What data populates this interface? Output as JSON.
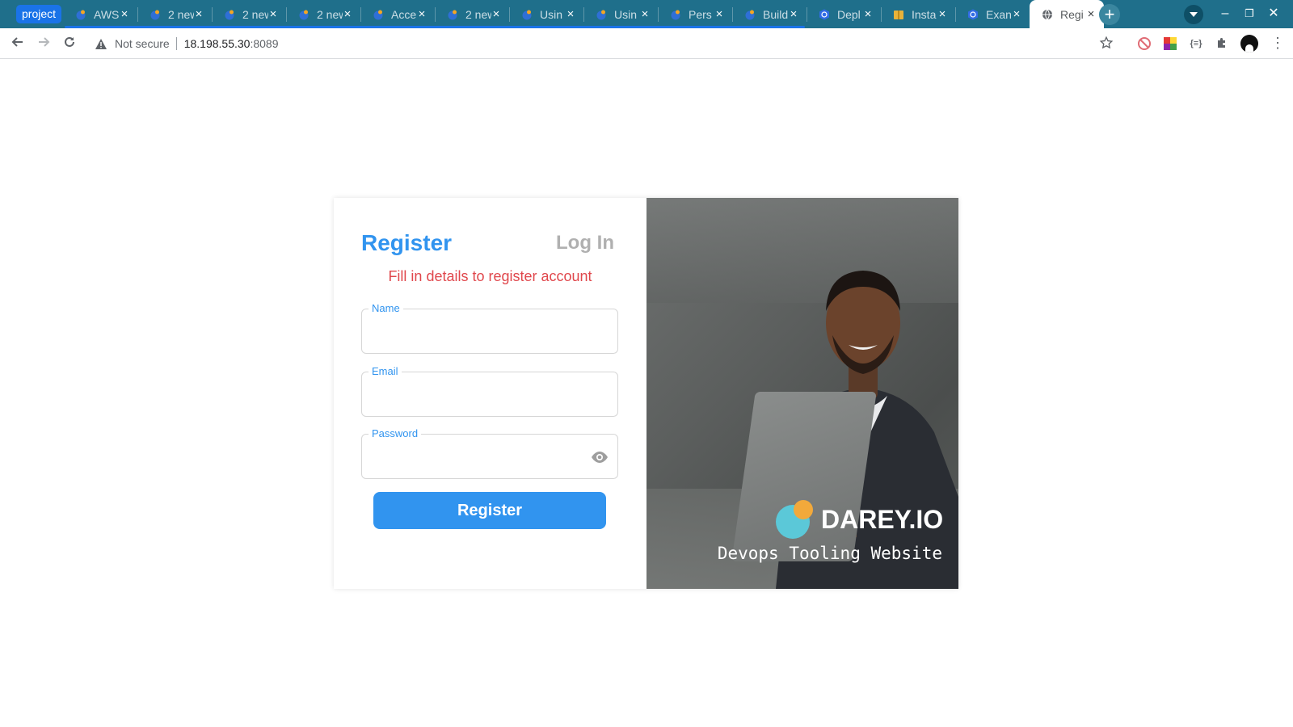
{
  "browser": {
    "tab_group_label": "project",
    "tabs": [
      {
        "title": "AWS",
        "icon": "blog-favicon"
      },
      {
        "title": "2 new",
        "icon": "blog-favicon"
      },
      {
        "title": "2 new",
        "icon": "blog-favicon"
      },
      {
        "title": "2 new",
        "icon": "blog-favicon"
      },
      {
        "title": "Acce",
        "icon": "blog-favicon"
      },
      {
        "title": "2 new",
        "icon": "blog-favicon"
      },
      {
        "title": "Usin",
        "icon": "blog-favicon"
      },
      {
        "title": "Usin",
        "icon": "blog-favicon"
      },
      {
        "title": "Pers",
        "icon": "blog-favicon"
      },
      {
        "title": "Build",
        "icon": "blog-favicon"
      },
      {
        "title": "Depl",
        "icon": "kubernetes-favicon"
      },
      {
        "title": "Insta",
        "icon": "package-favicon"
      },
      {
        "title": "Exan",
        "icon": "kubernetes-favicon"
      },
      {
        "title": "Regi",
        "icon": "globe-favicon",
        "active": true
      }
    ],
    "address": {
      "security_label": "Not secure",
      "host": "18.198.55.30",
      "port": ":8089"
    }
  },
  "form": {
    "register_tab": "Register",
    "login_tab": "Log In",
    "subtitle": "Fill in details to register account",
    "name_label": "Name",
    "email_label": "Email",
    "password_label": "Password",
    "name_value": "",
    "email_value": "",
    "password_value": "",
    "submit_label": "Register"
  },
  "brand": {
    "name": "DAREY.IO",
    "tagline": "Devops Tooling Website"
  },
  "colors": {
    "accent": "#3194ef",
    "subtitle": "#e0474c",
    "tabstrip": "#1f6f8b",
    "logo_teal": "#5bc8d8",
    "logo_orange": "#f2a93b"
  }
}
